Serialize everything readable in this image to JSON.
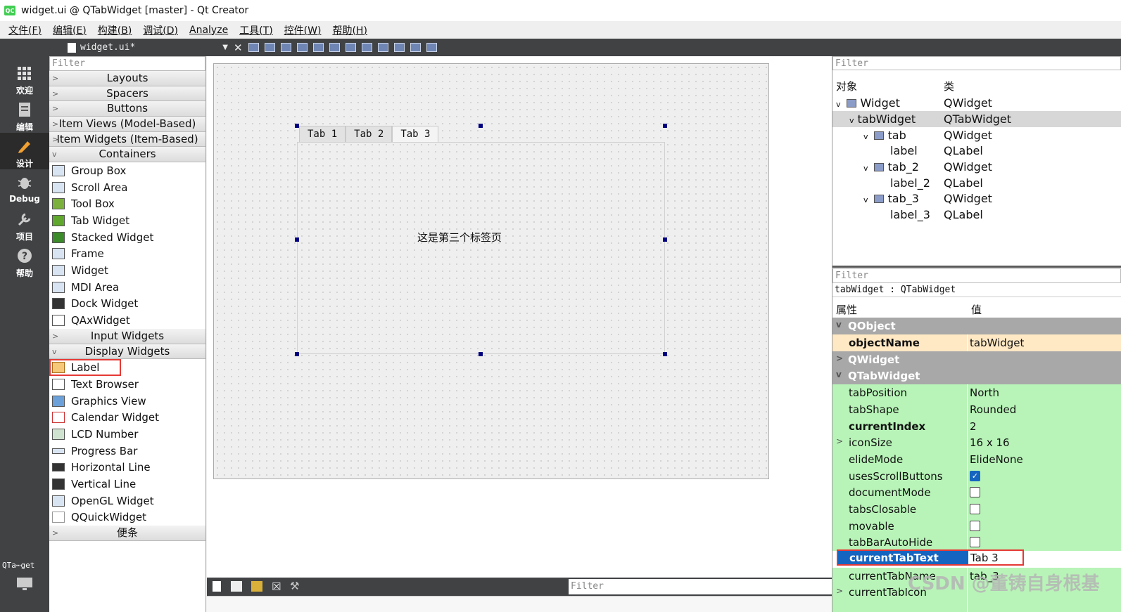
{
  "window": {
    "title": "widget.ui @ QTabWidget [master] - Qt Creator",
    "logo": "QC"
  },
  "menu": [
    "文件(F)",
    "编辑(E)",
    "构建(B)",
    "调试(D)",
    "Analyze",
    "工具(T)",
    "控件(W)",
    "帮助(H)"
  ],
  "modes": [
    {
      "label": "欢迎",
      "icon": "grid-icon"
    },
    {
      "label": "编辑",
      "icon": "edit-doc-icon"
    },
    {
      "label": "设计",
      "icon": "pencil-icon"
    },
    {
      "label": "Debug",
      "icon": "bug-icon"
    },
    {
      "label": "项目",
      "icon": "wrench-icon"
    },
    {
      "label": "帮助",
      "icon": "help-icon"
    }
  ],
  "mode_bottom": "QTa⋯get",
  "doc": {
    "filename": "widget.ui*"
  },
  "widgetbox": {
    "filter": "Filter",
    "categories_top": [
      "Layouts",
      "Spacers",
      "Buttons",
      "Item Views (Model-Based)",
      "Item Widgets (Item-Based)",
      "Containers"
    ],
    "containers": [
      "Group Box",
      "Scroll Area",
      "Tool Box",
      "Tab Widget",
      "Stacked Widget",
      "Frame",
      "Widget",
      "MDI Area",
      "Dock Widget",
      "QAxWidget"
    ],
    "categories_mid": [
      "Input Widgets",
      "Display Widgets"
    ],
    "display": [
      "Label",
      "Text Browser",
      "Graphics View",
      "Calendar Widget",
      "LCD Number",
      "Progress Bar",
      "Horizontal Line",
      "Vertical Line",
      "OpenGL Widget",
      "QQuickWidget"
    ],
    "last_category": "便条"
  },
  "form": {
    "tabs": [
      "Tab 1",
      "Tab 2",
      "Tab 3"
    ],
    "page_label": "这是第三个标签页"
  },
  "bottom": {
    "filter": "Filter"
  },
  "objects": {
    "filter": "Filter",
    "headers": [
      "对象",
      "类"
    ],
    "rows": [
      {
        "name": "Widget",
        "cls": "QWidget"
      },
      {
        "name": "tabWidget",
        "cls": "QTabWidget"
      },
      {
        "name": "tab",
        "cls": "QWidget"
      },
      {
        "name": "label",
        "cls": "QLabel"
      },
      {
        "name": "tab_2",
        "cls": "QWidget"
      },
      {
        "name": "label_2",
        "cls": "QLabel"
      },
      {
        "name": "tab_3",
        "cls": "QWidget"
      },
      {
        "name": "label_3",
        "cls": "QLabel"
      }
    ]
  },
  "props": {
    "filter": "Filter",
    "selected": "tabWidget : QTabWidget",
    "headers": [
      "属性",
      "值"
    ],
    "s_qobject": "QObject",
    "objectName": {
      "name": "objectName",
      "value": "tabWidget"
    },
    "s_qwidget": "QWidget",
    "s_qtab": "QTabWidget",
    "tabPosition": {
      "name": "tabPosition",
      "value": "North"
    },
    "tabShape": {
      "name": "tabShape",
      "value": "Rounded"
    },
    "currentIndex": {
      "name": "currentIndex",
      "value": "2"
    },
    "iconSize": {
      "name": "iconSize",
      "value": "16 x 16"
    },
    "elideMode": {
      "name": "elideMode",
      "value": "ElideNone"
    },
    "usesScrollButtons": {
      "name": "usesScrollButtons",
      "checked": true
    },
    "documentMode": {
      "name": "documentMode",
      "checked": false
    },
    "tabsClosable": {
      "name": "tabsClosable",
      "checked": false
    },
    "movable": {
      "name": "movable",
      "checked": false
    },
    "tabBarAutoHide": {
      "name": "tabBarAutoHide",
      "checked": false
    },
    "currentTabText": {
      "name": "currentTabText",
      "value": "Tab 3"
    },
    "currentTabName": {
      "name": "currentTabName",
      "value": "tab_3"
    },
    "currentTabIcon": {
      "name": "currentTabIcon"
    }
  },
  "watermark": "CSDN @董铸自身根基"
}
